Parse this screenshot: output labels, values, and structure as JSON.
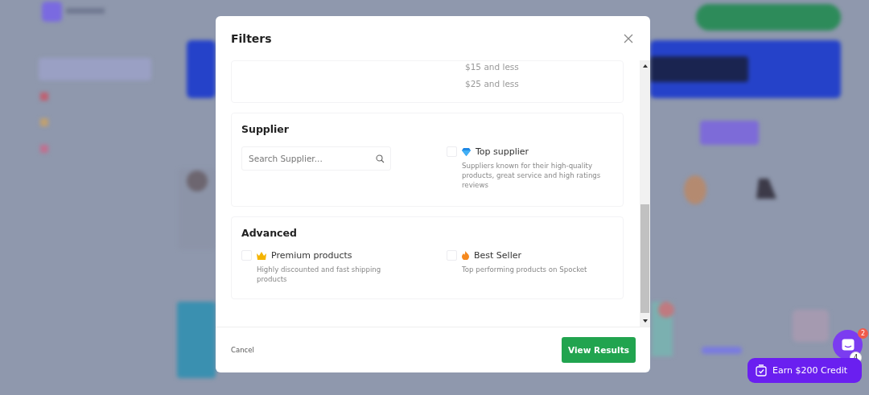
{
  "dialog": {
    "title": "Filters",
    "price_options": [
      {
        "label": "$15 and less"
      },
      {
        "label": "$25 and less"
      }
    ],
    "sections": [
      {
        "title": "Supplier",
        "search": {
          "placeholder": "Search Supplier..."
        },
        "options": [
          {
            "label": "Top supplier",
            "description": "Suppliers known for their high-quality products, great service and high ratings reviews",
            "checked": false
          }
        ]
      },
      {
        "title": "Advanced",
        "options": [
          {
            "label": "Premium products",
            "description": "Highly discounted and fast shipping products",
            "checked": false
          },
          {
            "label": "Best Seller",
            "description": "Top performing products on Spocket",
            "checked": false
          }
        ]
      }
    ],
    "cancel": "Cancel",
    "submit": "View Results"
  },
  "chat": {
    "badge": "2",
    "count": "4"
  },
  "credit_button": {
    "label": "Earn $200 Credit"
  }
}
